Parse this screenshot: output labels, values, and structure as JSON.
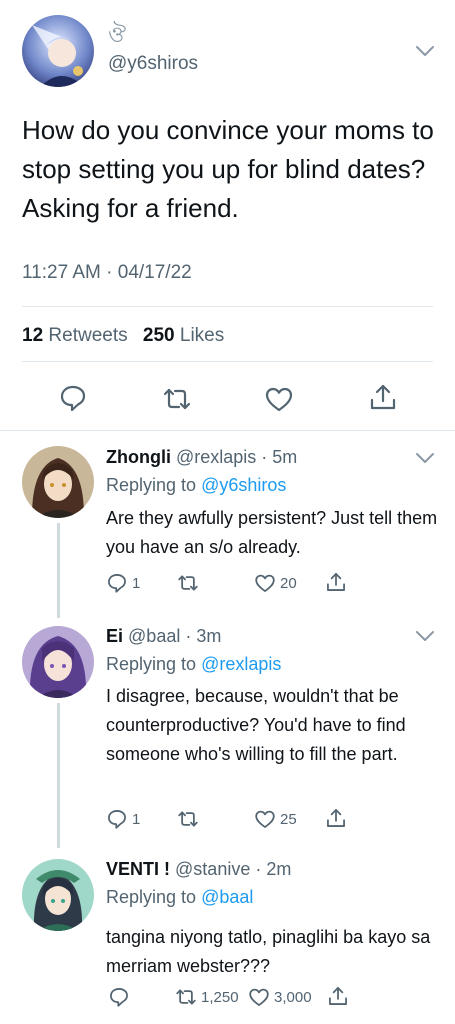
{
  "main_tweet": {
    "display_name_glyph": "ঔ",
    "handle": "@y6shiros",
    "text": "How do you convince your moms to stop setting you up for blind dates? Asking for a friend.",
    "timestamp": "11:27 AM · 04/17/22",
    "retweets_count": "12",
    "retweets_label": "Retweets",
    "likes_count": "250",
    "likes_label": "Likes",
    "actions": [
      "reply-icon",
      "retweet-icon",
      "like-icon",
      "share-icon"
    ]
  },
  "replies": [
    {
      "name": "Zhongli",
      "handle_time": "@rexlapis · 5m",
      "replying_prefix": "Replying to",
      "replying_to": "@y6shiros",
      "text": "Are they awfully persistent? Just tell them you have an s/o already.",
      "reply_count": "1",
      "retweet_count": "",
      "like_count": "20"
    },
    {
      "name": "Ei",
      "handle_time": "@baal · 3m",
      "replying_prefix": "Replying to",
      "replying_to": "@rexlapis",
      "text": "I disagree, because, wouldn't that be counterproductive? You'd have to find someone who's willing to fill the part.",
      "reply_count": "1",
      "retweet_count": "",
      "like_count": "25"
    },
    {
      "name": "VENTI !",
      "handle_time": "@stanive · 2m",
      "replying_prefix": "Replying to",
      "replying_to": "@baal",
      "text": "tangina niyong tatlo, pinaglihi ba kayo sa merriam webster???",
      "reply_count": "",
      "retweet_count": "1,250",
      "like_count": "3,000"
    }
  ],
  "colors": {
    "link": "#1d9bf0",
    "secondary_text": "#536471",
    "divider": "#e1e8ed"
  }
}
